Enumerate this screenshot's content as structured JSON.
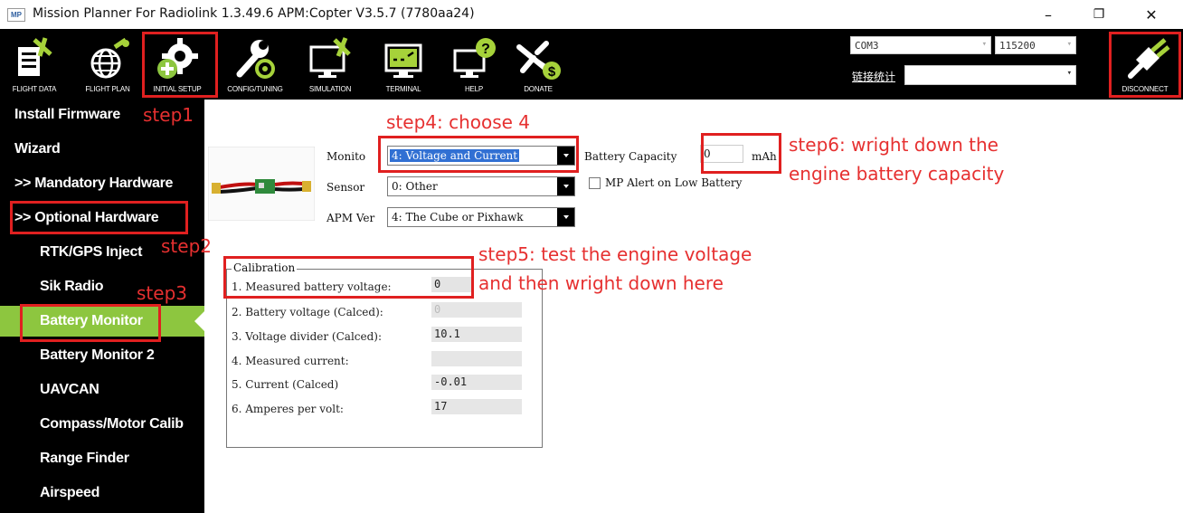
{
  "window": {
    "logo_text": "MP",
    "title": "Mission Planner For Radiolink 1.3.49.6 APM:Copter V3.5.7 (7780aa24)",
    "minimize": "–",
    "maximize": "❐",
    "close": "✕"
  },
  "toolbar": {
    "items": [
      {
        "label": "FLIGHT DATA",
        "icon": "flight-data-icon"
      },
      {
        "label": "FLIGHT PLAN",
        "icon": "flight-plan-icon"
      },
      {
        "label": "INITIAL SETUP",
        "icon": "initial-setup-icon"
      },
      {
        "label": "CONFIG/TUNING",
        "icon": "config-tuning-icon"
      },
      {
        "label": "SIMULATION",
        "icon": "simulation-icon"
      },
      {
        "label": "TERMINAL",
        "icon": "terminal-icon"
      },
      {
        "label": "HELP",
        "icon": "help-icon"
      },
      {
        "label": "DONATE",
        "icon": "donate-icon"
      }
    ],
    "port": "COM3",
    "baud": "115200",
    "stats_label": "链接统计",
    "disconnect_label": "DISCONNECT"
  },
  "sidebar": {
    "items": [
      {
        "label": "Install Firmware",
        "active": false
      },
      {
        "label": "Wizard",
        "active": false
      },
      {
        "label": ">> Mandatory Hardware",
        "active": false
      },
      {
        "label": ">> Optional Hardware",
        "active": false
      },
      {
        "label": "RTK/GPS Inject",
        "active": false
      },
      {
        "label": "Sik Radio",
        "active": false
      },
      {
        "label": "Battery Monitor",
        "active": true
      },
      {
        "label": "Battery Monitor 2",
        "active": false
      },
      {
        "label": "UAVCAN",
        "active": false
      },
      {
        "label": "Compass/Motor Calib",
        "active": false
      },
      {
        "label": "Range Finder",
        "active": false
      },
      {
        "label": "Airspeed",
        "active": false
      }
    ]
  },
  "battery_monitor": {
    "monitor_label": "Monito",
    "monitor_value": "4: Voltage and Current",
    "sensor_label": "Sensor",
    "sensor_value": "0: Other",
    "apm_label": "APM Ver",
    "apm_value": "4: The Cube or Pixhawk",
    "capacity_label": "Battery Capacity",
    "capacity_value": "0",
    "capacity_unit": "mAh",
    "alert_label": "MP Alert on Low Battery",
    "alert_checked": false
  },
  "calibration": {
    "title": "Calibration",
    "rows": [
      {
        "label": "1. Measured battery voltage:",
        "value": "0"
      },
      {
        "label": "2. Battery voltage (Calced):",
        "value": "0"
      },
      {
        "label": "3. Voltage divider (Calced):",
        "value": "10.1"
      },
      {
        "label": "4. Measured current:",
        "value": ""
      },
      {
        "label": "5. Current (Calced)",
        "value": "-0.01"
      },
      {
        "label": "6. Amperes per volt:",
        "value": "17"
      }
    ]
  },
  "annotations": {
    "step1": "step1",
    "step2": "step2",
    "step3": "step3",
    "step4": "step4: choose 4",
    "step5_line1": "step5: test the engine voltage",
    "step5_line2": "and then wright down  here",
    "step6_line1": "step6: wright down the",
    "step6_line2": "engine battery capacity"
  },
  "colors": {
    "toolbar_bg": "#000000",
    "active_item": "#8dc63f",
    "annotation": "#e02020",
    "selection": "#3170d3"
  }
}
